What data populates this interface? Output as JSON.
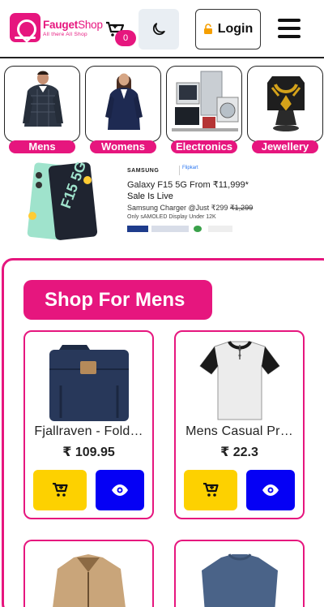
{
  "brand": {
    "name_part1": "Fauget",
    "name_part2": "Shop",
    "tagline": "All there All Shop"
  },
  "header": {
    "cart_count": "0",
    "login_label": "Login"
  },
  "categories": [
    {
      "label": "Mens"
    },
    {
      "label": "Womens"
    },
    {
      "label": "Electronics"
    },
    {
      "label": "Jewellery"
    }
  ],
  "banner": {
    "brand": "SAMSUNG",
    "partner": "Flipkart",
    "title": "Galaxy F15 5G From ₹11,999*",
    "subtitle": "Sale Is Live",
    "charger": "Samsung Charger @Just ₹299",
    "charger_old": "₹1,299",
    "only": "Only sAMOLED Display Under 12K",
    "phone_label": "F15 5G"
  },
  "section": {
    "heading": "Shop For Mens"
  },
  "products": [
    {
      "title": "Fjallraven - Fold…",
      "price": "₹ 109.95"
    },
    {
      "title": "Mens Casual Pr…",
      "price": "₹ 22.3"
    },
    {
      "title": "",
      "price": ""
    },
    {
      "title": "",
      "price": ""
    }
  ],
  "colors": {
    "accent": "#e6167e",
    "cart_button": "#fdd100",
    "view_button": "#0500f5"
  }
}
